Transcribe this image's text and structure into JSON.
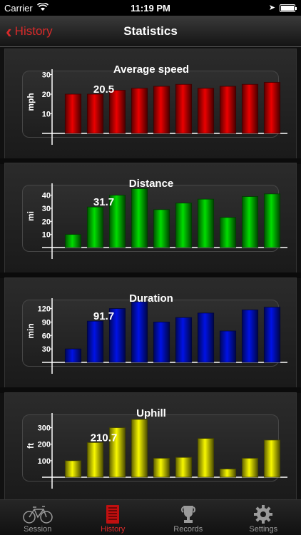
{
  "status": {
    "carrier": "Carrier",
    "time": "11:19 PM"
  },
  "nav": {
    "back_label": "History",
    "title": "Statistics"
  },
  "charts": [
    {
      "title": "Average speed",
      "unit": "mph",
      "highlight_label": "20.5",
      "color": "#cc0000"
    },
    {
      "title": "Distance",
      "unit": "mi",
      "highlight_label": "31.7",
      "color": "#00c000"
    },
    {
      "title": "Duration",
      "unit": "min",
      "highlight_label": "91.7",
      "color": "#0010c8"
    },
    {
      "title": "Uphill",
      "unit": "ft",
      "highlight_label": "210.7",
      "color": "#d8d800"
    }
  ],
  "chart_data": [
    {
      "type": "bar",
      "title": "Average speed",
      "ylabel": "mph",
      "yticks": [
        10,
        20,
        30
      ],
      "ylim": [
        0,
        32
      ],
      "values": [
        20,
        20,
        22,
        23,
        24,
        25,
        23,
        24,
        25,
        26
      ],
      "highlight_index": 1,
      "highlight_value": "20.5"
    },
    {
      "type": "bar",
      "title": "Distance",
      "ylabel": "mi",
      "yticks": [
        10,
        20,
        30,
        40
      ],
      "ylim": [
        0,
        48
      ],
      "values": [
        10,
        31,
        40,
        45,
        29,
        34,
        37,
        23,
        39,
        41
      ],
      "highlight_index": 1,
      "highlight_value": "31.7"
    },
    {
      "type": "bar",
      "title": "Duration",
      "ylabel": "min",
      "yticks": [
        30,
        60,
        90,
        120
      ],
      "ylim": [
        0,
        140
      ],
      "values": [
        30,
        92,
        120,
        135,
        90,
        100,
        110,
        70,
        117,
        123
      ],
      "highlight_index": 1,
      "highlight_value": "91.7"
    },
    {
      "type": "bar",
      "title": "Uphill",
      "ylabel": "ft",
      "yticks": [
        100,
        200,
        300
      ],
      "ylim": [
        0,
        380
      ],
      "values": [
        100,
        210,
        300,
        350,
        115,
        120,
        235,
        50,
        115,
        225
      ],
      "highlight_index": 1,
      "highlight_value": "210.7"
    }
  ],
  "tabs": [
    {
      "label": "Session",
      "icon": "bicycle-icon"
    },
    {
      "label": "History",
      "icon": "list-icon",
      "active": true
    },
    {
      "label": "Records",
      "icon": "trophy-icon"
    },
    {
      "label": "Settings",
      "icon": "gear-icon"
    }
  ]
}
